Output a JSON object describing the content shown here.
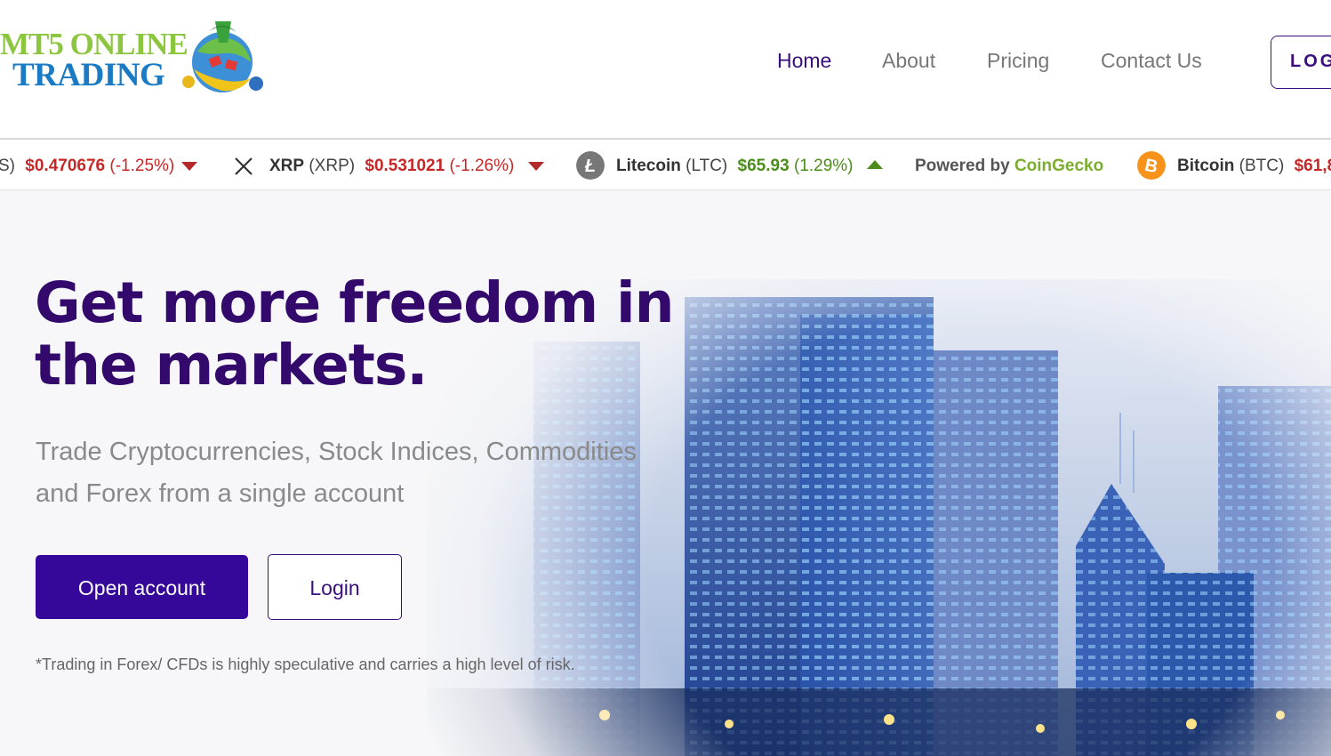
{
  "logo": {
    "line1": "MT5 ONLINE",
    "line2": "TRADING",
    "mark_icon": "metatrader-globe-icon"
  },
  "nav": {
    "items": [
      {
        "label": "Home",
        "active": true
      },
      {
        "label": "About",
        "active": false
      },
      {
        "label": "Pricing",
        "active": false
      },
      {
        "label": "Contact Us",
        "active": false
      }
    ],
    "login_label": "LOG"
  },
  "ticker": {
    "items": [
      {
        "prefix": "S)",
        "name": "",
        "symbol": "",
        "price": "$0.470676",
        "change": "(-1.25%)",
        "direction": "down",
        "icon": ""
      },
      {
        "prefix": "",
        "name": "XRP",
        "symbol": "(XRP)",
        "price": "$0.531021",
        "change": "(-1.26%)",
        "direction": "down",
        "icon": "xrp-icon"
      },
      {
        "prefix": "",
        "name": "Litecoin",
        "symbol": "(LTC)",
        "price": "$65.93",
        "change": "(1.29%)",
        "direction": "up",
        "icon": "litecoin-icon"
      },
      {
        "prefix": "",
        "name": "Bitcoin",
        "symbol": "(BTC)",
        "price": "$61,8",
        "change": "",
        "direction": "down",
        "icon": "bitcoin-icon"
      }
    ],
    "powered_by": "Powered by",
    "powered_brand": "CoinGecko"
  },
  "hero": {
    "title": "Get more freedom in the markets.",
    "subtitle": "Trade Cryptocurrencies, Stock Indices, Commodities and Forex from a single account",
    "open_account_label": "Open account",
    "login_label": "Login",
    "disclaimer": "*Trading in Forex/ CFDs is highly speculative and carries a high level of risk."
  },
  "colors": {
    "brand_purple": "#35089a",
    "title_purple": "#330a6b",
    "down_red": "#c62828",
    "up_green": "#4c8d1a",
    "coingecko_green": "#7cae2e",
    "logo_green": "#8cc63f",
    "logo_blue": "#1a7bc4"
  }
}
